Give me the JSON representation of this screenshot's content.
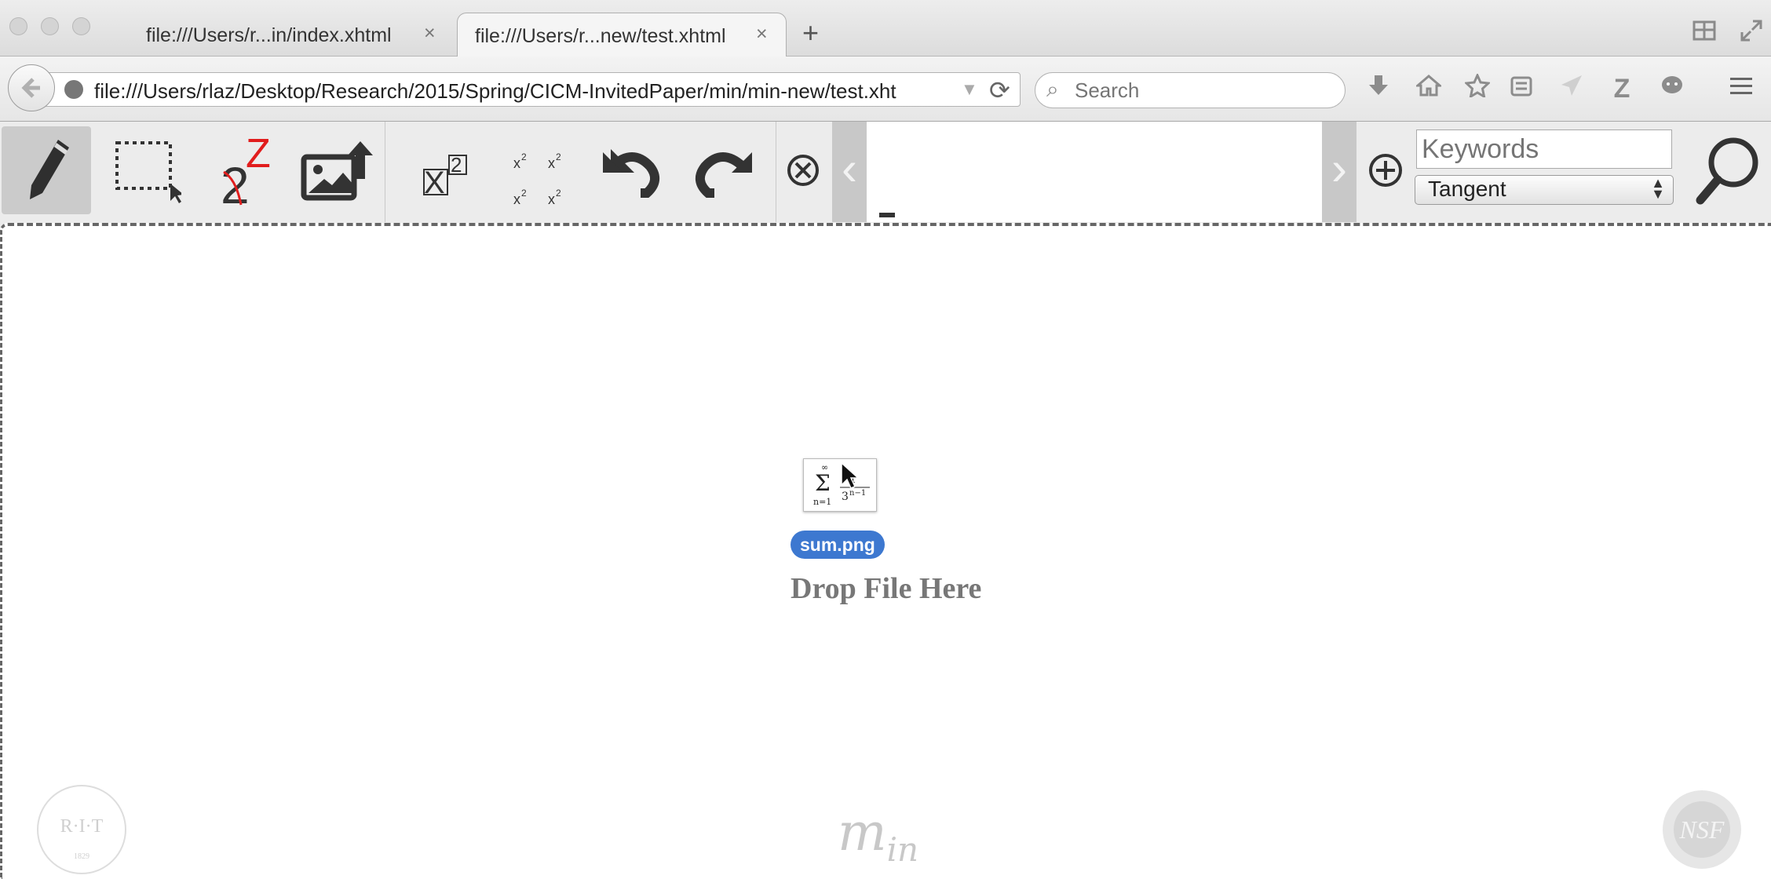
{
  "window": {
    "tabs": [
      {
        "label": "file:///Users/r...in/index.xhtml",
        "active": false
      },
      {
        "label": "file:///Users/r...new/test.xhtml",
        "active": true
      }
    ],
    "new_tab": "+",
    "close_glyph": "×"
  },
  "nav": {
    "url": "file:///Users/rlaz/Desktop/Research/2015/Spring/CICM-InvitedPaper/min/min-new/test.xht",
    "search_placeholder": "Search",
    "icons": [
      "download-icon",
      "home-icon",
      "bookmark-star-icon",
      "reading-list-icon",
      "send-icon",
      "zotero-icon",
      "chat-icon",
      "menu-icon"
    ]
  },
  "toolbar": {
    "tools": [
      "pencil-icon",
      "selection-rectangle-icon",
      "rotate-math-icon",
      "image-upload-icon",
      "superscript-icon",
      "matrix-superscript-icon",
      "undo-icon",
      "redo-icon",
      "clear-icon"
    ],
    "keywords_placeholder": "Keywords",
    "search_mode": "Tangent",
    "search_mode_options": [
      "Tangent"
    ],
    "accent_color": "#e11d1d"
  },
  "drop": {
    "file_name": "sum.png",
    "drop_label": "Drop File Here",
    "badge_color": "#3d78d0"
  },
  "footer": {
    "logo_text": "m",
    "logo_sub": "in",
    "rit_text": "R·I·T",
    "rit_year": "1829",
    "nsf_text": "NSF"
  }
}
